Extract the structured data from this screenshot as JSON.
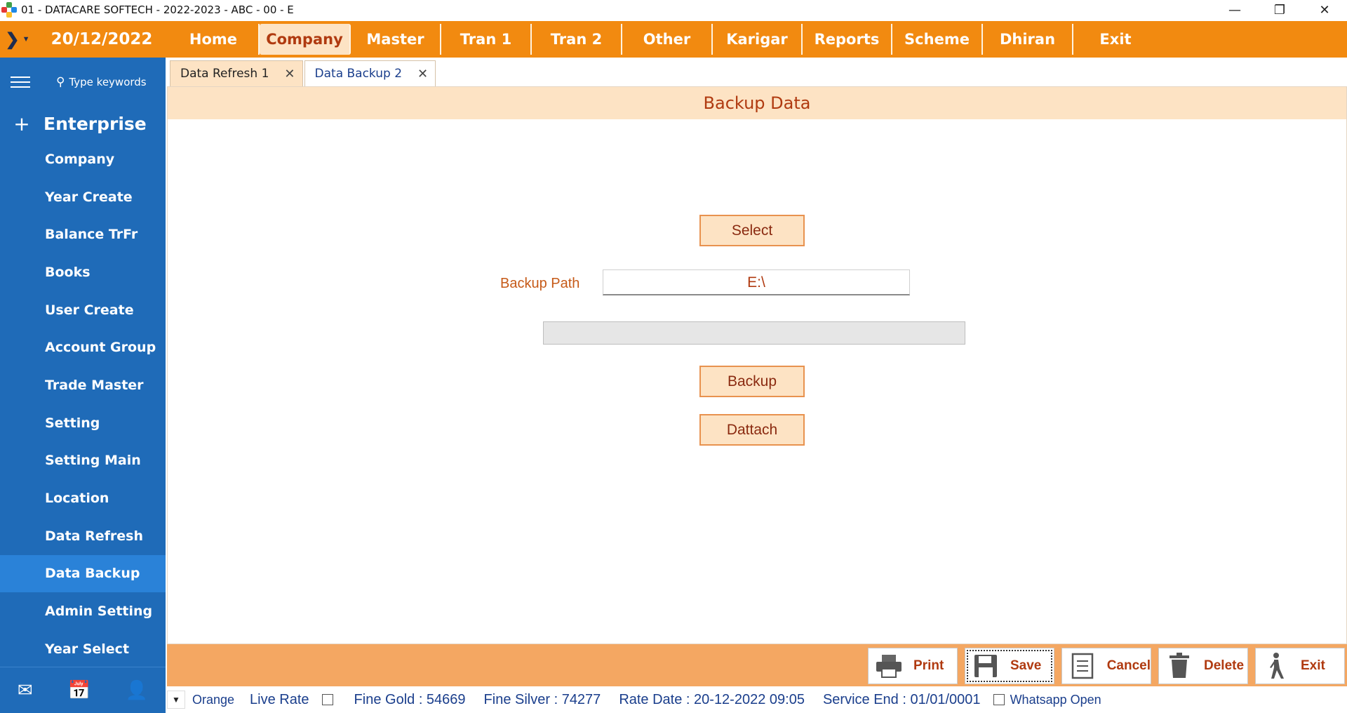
{
  "window": {
    "title": "01 - DATACARE SOFTECH - 2022-2023 - ABC - 00 - E",
    "controls": [
      "minimize",
      "restore",
      "close"
    ]
  },
  "menubar": {
    "date": "20/12/2022",
    "items": [
      "Home",
      "Company",
      "Master",
      "Tran 1",
      "Tran 2",
      "Other",
      "Karigar",
      "Reports",
      "Scheme",
      "Dhiran",
      "Exit"
    ],
    "active": "Company",
    "accent_color": "#f28a10"
  },
  "sidebar": {
    "search_placeholder": "Type keywords",
    "section_title": "Enterprise",
    "items": [
      "Company",
      "Year Create",
      "Balance TrFr",
      "Books",
      "User Create",
      "Account Group",
      "Trade Master",
      "Setting",
      "Setting Main",
      "Location",
      "Data Refresh",
      "Data Backup",
      "Admin Setting",
      "Year Select"
    ],
    "selected": "Data Backup",
    "background_color": "#1f6bb8"
  },
  "tabs": [
    {
      "label": "Data Refresh 1",
      "active": false
    },
    {
      "label": "Data Backup 2",
      "active": true
    }
  ],
  "form": {
    "header": "Backup Data",
    "select_label": "Select",
    "path_label": "Backup Path",
    "path_value": "E:\\",
    "progress_percent": 0,
    "backup_label": "Backup",
    "dattach_label": "Dattach"
  },
  "actions": {
    "print": "Print",
    "save": "Save",
    "cancel": "Cancel",
    "delete": "Delete",
    "exit": "Exit"
  },
  "status": {
    "theme": "Orange",
    "live_rate": "Live Rate",
    "live_rate_checked": false,
    "fine_gold": "Fine Gold : 54669",
    "fine_silver": "Fine Silver : 74277",
    "rate_date": "Rate Date : 20-12-2022 09:05",
    "service_end": "Service End :  01/01/0001",
    "whatsapp": "Whatsapp Open",
    "whatsapp_checked": false
  }
}
